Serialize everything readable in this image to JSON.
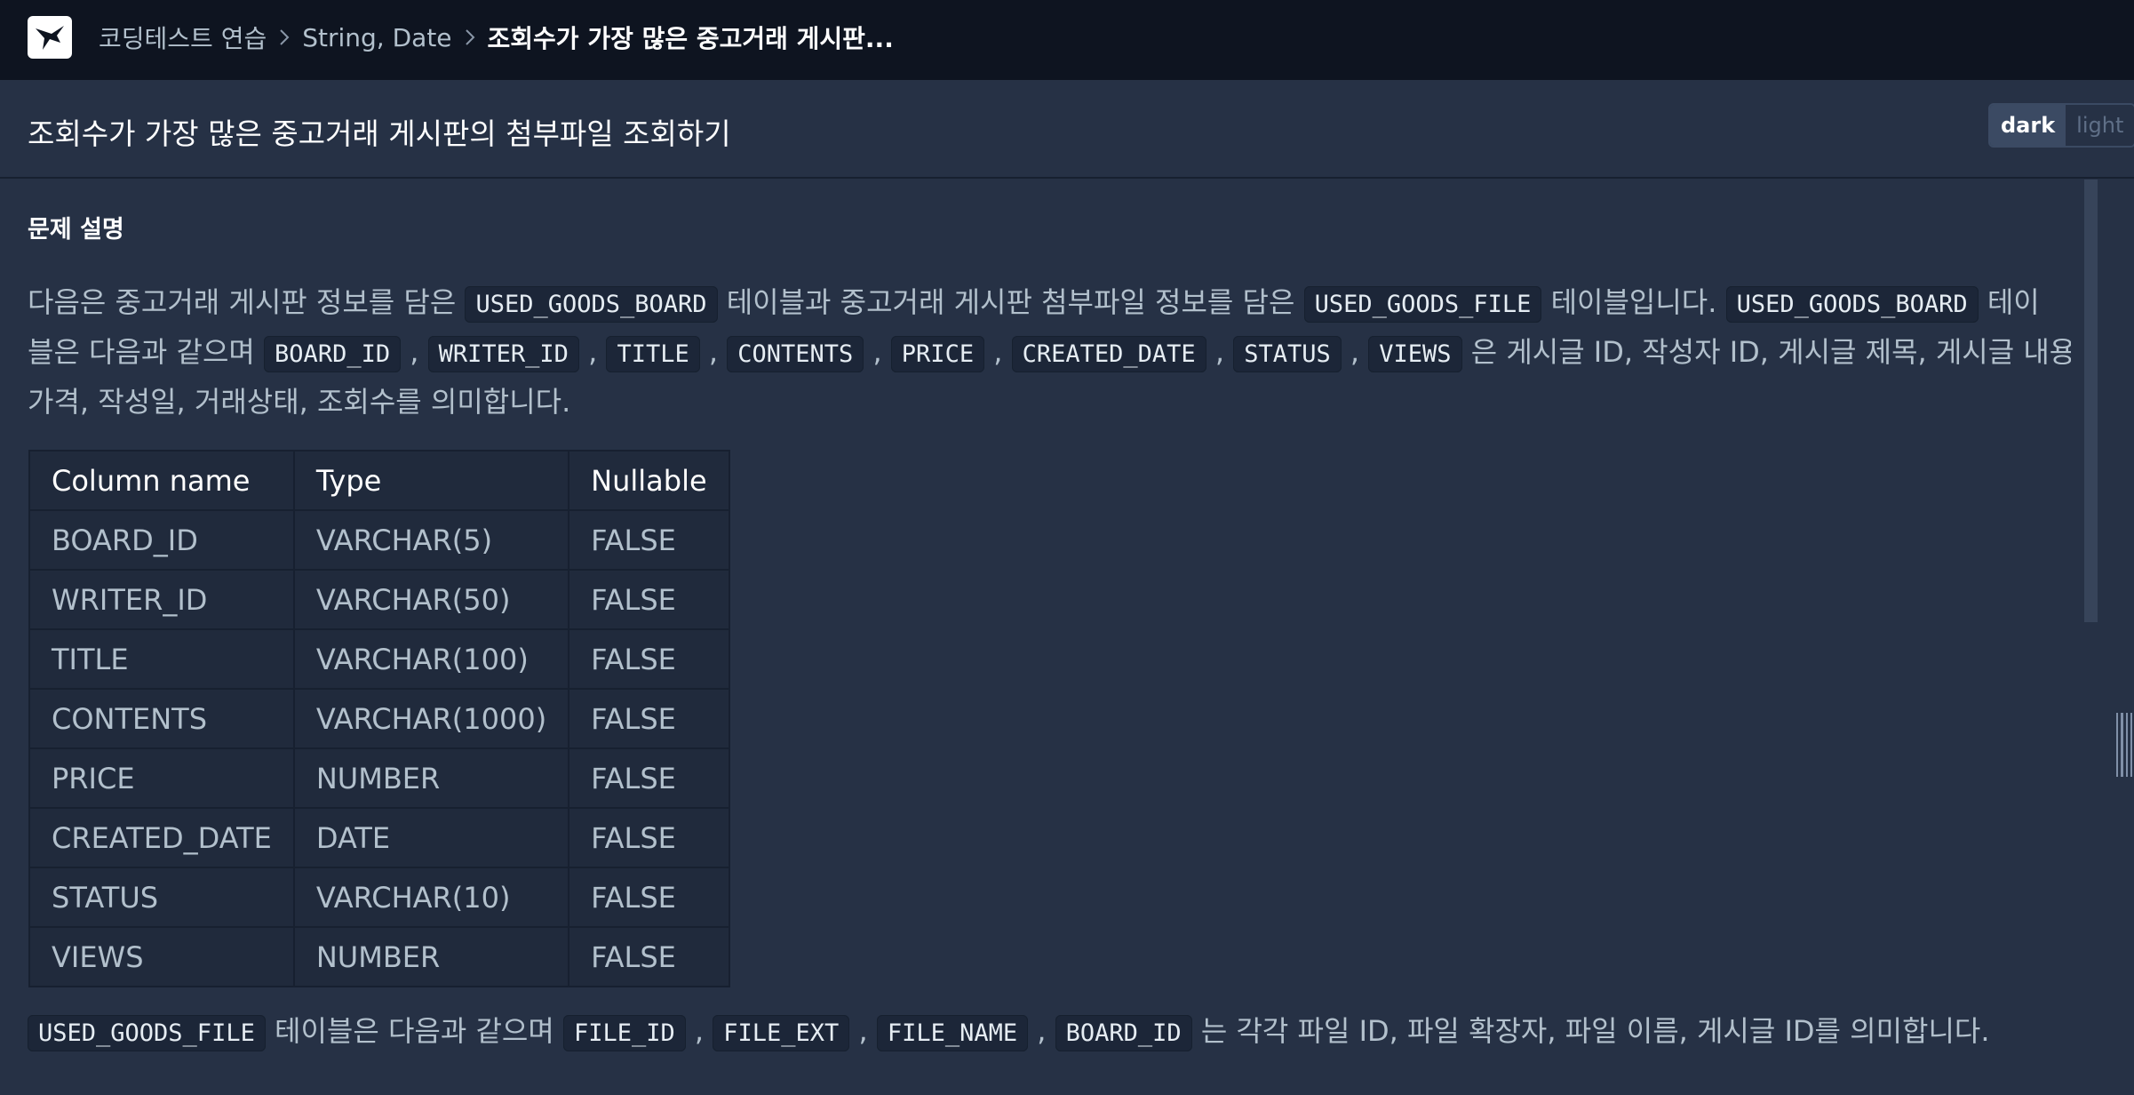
{
  "breadcrumb": {
    "items": [
      "코딩테스트 연습",
      "String, Date"
    ],
    "current": "조회수가 가장 많은 중고거래 게시판..."
  },
  "header": {
    "title": "조회수가 가장 많은 중고거래 게시판의 첨부파일 조회하기"
  },
  "theme": {
    "dark": "dark",
    "light": "light"
  },
  "section": {
    "heading": "문제 설명"
  },
  "description": {
    "p1_a": "다음은 중고거래 게시판 정보를 담은 ",
    "p1_code1": "USED_GOODS_BOARD",
    "p1_b": " 테이블과 중고거래 게시판 첨부파일 정보를 담은 ",
    "p1_code2": "USED_GOODS_FILE",
    "p1_c": " 테이블입니다. ",
    "p1_code3": "USED_GOODS_BOARD",
    "p1_d": " 테이",
    "p2_a": "블은 다음과 같으며 ",
    "p2_codes": [
      "BOARD_ID",
      "WRITER_ID",
      "TITLE",
      "CONTENTS",
      "PRICE",
      "CREATED_DATE",
      "STATUS",
      "VIEWS"
    ],
    "comma": " , ",
    "p2_b": " 은 게시글 ID, 작성자 ID, 게시글 제목, 게시글 내용,",
    "p3": "가격, 작성일, 거래상태, 조회수를 의미합니다.",
    "p4_code": "USED_GOODS_FILE",
    "p4_a": " 테이블은 다음과 같으며 ",
    "p4_codes": [
      "FILE_ID",
      "FILE_EXT",
      "FILE_NAME",
      "BOARD_ID"
    ],
    "p4_b": " 는 각각 파일 ID, 파일 확장자, 파일 이름, 게시글 ID를 의미합니다."
  },
  "table": {
    "headers": [
      "Column name",
      "Type",
      "Nullable"
    ],
    "rows": [
      [
        "BOARD_ID",
        "VARCHAR(5)",
        "FALSE"
      ],
      [
        "WRITER_ID",
        "VARCHAR(50)",
        "FALSE"
      ],
      [
        "TITLE",
        "VARCHAR(100)",
        "FALSE"
      ],
      [
        "CONTENTS",
        "VARCHAR(1000)",
        "FALSE"
      ],
      [
        "PRICE",
        "NUMBER",
        "FALSE"
      ],
      [
        "CREATED_DATE",
        "DATE",
        "FALSE"
      ],
      [
        "STATUS",
        "VARCHAR(10)",
        "FALSE"
      ],
      [
        "VIEWS",
        "NUMBER",
        "FALSE"
      ]
    ]
  },
  "colors": {
    "topbar": "#0e1420",
    "panel": "#263145",
    "text": "#b2c0cc",
    "code_bg": "#1c2638"
  }
}
